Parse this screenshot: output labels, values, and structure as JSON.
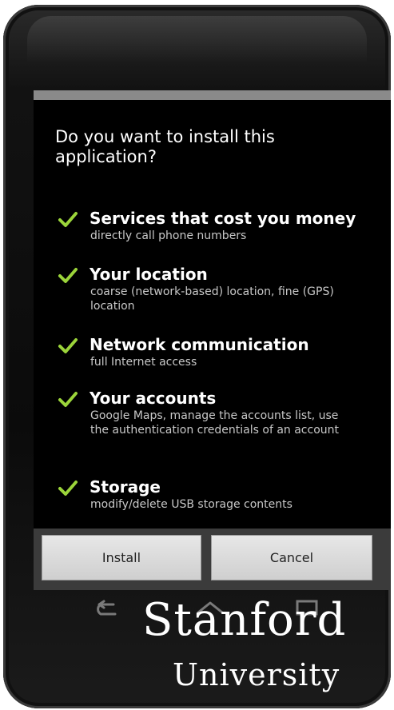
{
  "dialog": {
    "question": "Do you want to install this application?",
    "permissions": [
      {
        "title": "Services that cost you money",
        "description": "directly call phone numbers"
      },
      {
        "title": "Your location",
        "description": "coarse (network-based) location, fine (GPS) location"
      },
      {
        "title": "Network communication",
        "description": "full Internet access"
      },
      {
        "title": "Your accounts",
        "description": "Google Maps, manage the accounts list, use the authentication credentials of an account"
      },
      {
        "title": "Storage",
        "description": "modify/delete USB storage contents"
      }
    ],
    "install_label": "Install",
    "cancel_label": "Cancel"
  },
  "nav": {
    "back_icon": "back-arrow-icon",
    "home_icon": "home-icon",
    "recent_icon": "recent-apps-icon"
  },
  "watermark": {
    "line1": "Stanford",
    "line2": "University"
  },
  "colors": {
    "check_green": "#9bd43a",
    "screen_bg": "#000000",
    "button_bar": "#3b3b3b",
    "status_strip": "#8a8a8a"
  }
}
